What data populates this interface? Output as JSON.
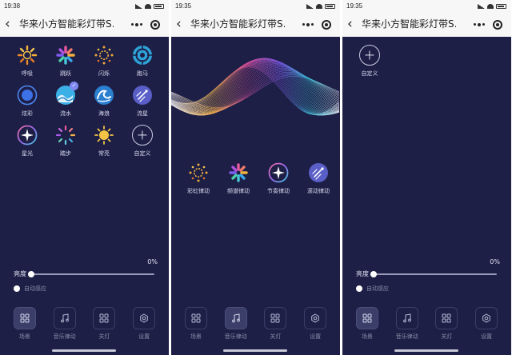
{
  "screens": [
    {
      "status": {
        "time": "19:38"
      },
      "header": {
        "title": "华来小方智能彩灯带S…"
      },
      "modes": [
        {
          "label": "呼吸",
          "icon": "breath-icon"
        },
        {
          "label": "跳跃",
          "icon": "jump-icon"
        },
        {
          "label": "闪烁",
          "icon": "flash-icon"
        },
        {
          "label": "跑马",
          "icon": "marquee-icon"
        },
        {
          "label": "炫彩",
          "icon": "dazzle-icon"
        },
        {
          "label": "流水",
          "icon": "flow-icon",
          "selected": true
        },
        {
          "label": "海浪",
          "icon": "wave-icon"
        },
        {
          "label": "流星",
          "icon": "meteor-icon"
        },
        {
          "label": "星光",
          "icon": "starlight-icon"
        },
        {
          "label": "踏步",
          "icon": "step-icon"
        },
        {
          "label": "常亮",
          "icon": "always-on-icon"
        },
        {
          "label": "自定义",
          "icon": "plus-icon"
        }
      ],
      "brightness": {
        "label": "亮度",
        "percent": "0%",
        "level": 0
      },
      "auto_sense": {
        "label": "自动感应"
      },
      "tabs": [
        {
          "label": "场景",
          "icon": "grid-icon",
          "active": true
        },
        {
          "label": "音乐律动",
          "icon": "music-icon"
        },
        {
          "label": "关灯",
          "icon": "grid-icon"
        },
        {
          "label": "设置",
          "icon": "gear-icon"
        }
      ]
    },
    {
      "status": {
        "time": "19:35"
      },
      "header": {
        "title": "华来小方智能彩灯带S…"
      },
      "music_modes": [
        {
          "label": "彩虹律动",
          "icon": "rainbow-icon"
        },
        {
          "label": "频谱律动",
          "icon": "spectrum-icon"
        },
        {
          "label": "节奏律动",
          "icon": "rhythm-icon"
        },
        {
          "label": "滚动律动",
          "icon": "scroll-icon"
        }
      ],
      "tabs": [
        {
          "label": "场景",
          "icon": "grid-icon"
        },
        {
          "label": "音乐律动",
          "icon": "music-icon",
          "active": true
        },
        {
          "label": "关灯",
          "icon": "grid-icon"
        },
        {
          "label": "设置",
          "icon": "gear-icon"
        }
      ]
    },
    {
      "status": {
        "time": "19:35"
      },
      "header": {
        "title": "华来小方智能彩灯带S…"
      },
      "custom": {
        "label": "自定义",
        "icon": "plus-icon"
      },
      "brightness": {
        "label": "亮度",
        "percent": "0%",
        "level": 0
      },
      "auto_sense": {
        "label": "自动感应"
      },
      "tabs": [
        {
          "label": "场景",
          "icon": "grid-icon",
          "active": true
        },
        {
          "label": "音乐律动",
          "icon": "music-icon"
        },
        {
          "label": "关灯",
          "icon": "grid-icon"
        },
        {
          "label": "设置",
          "icon": "gear-icon"
        }
      ]
    }
  ],
  "colors": {
    "background": "#1d1f46",
    "header": "#f7f7f7",
    "accent": "#7f87f0"
  }
}
